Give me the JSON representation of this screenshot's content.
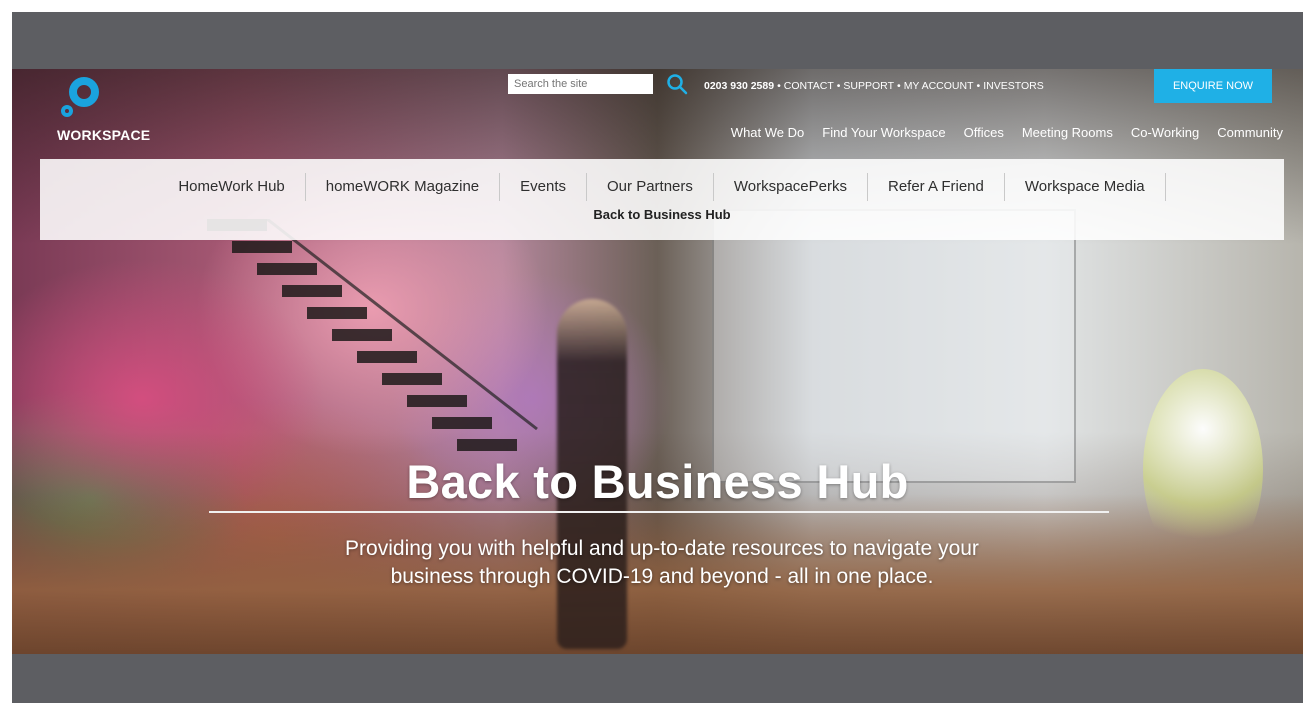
{
  "header": {
    "logo_text": "WORKSPACE",
    "search_placeholder": "Search the site",
    "utility": {
      "phone": "0203 930 2589",
      "contact": "CONTACT",
      "support": "SUPPORT",
      "account": "MY ACCOUNT",
      "investors": "INVESTORS",
      "separator": "•"
    },
    "enquire_label": "ENQUIRE NOW",
    "main_nav": [
      "What We Do",
      "Find Your Workspace",
      "Offices",
      "Meeting Rooms",
      "Co-Working",
      "Community"
    ]
  },
  "subnav": {
    "items": [
      "HomeWork Hub",
      "homeWORK Magazine",
      "Events",
      "Our Partners",
      "WorkspacePerks",
      "Refer A Friend",
      "Workspace Media"
    ],
    "active": "Back to Business Hub"
  },
  "hero": {
    "title": "Back to Business Hub",
    "subtitle_line1": "Providing you with helpful and up-to-date resources to navigate your",
    "subtitle_line2": "business through COVID-19 and beyond - all in one place."
  },
  "colors": {
    "brand_blue": "#1fb0e6",
    "frame_gray": "#5d5e62"
  },
  "icons": {
    "search": "search-icon",
    "logo": "workspace-logo-icon"
  }
}
